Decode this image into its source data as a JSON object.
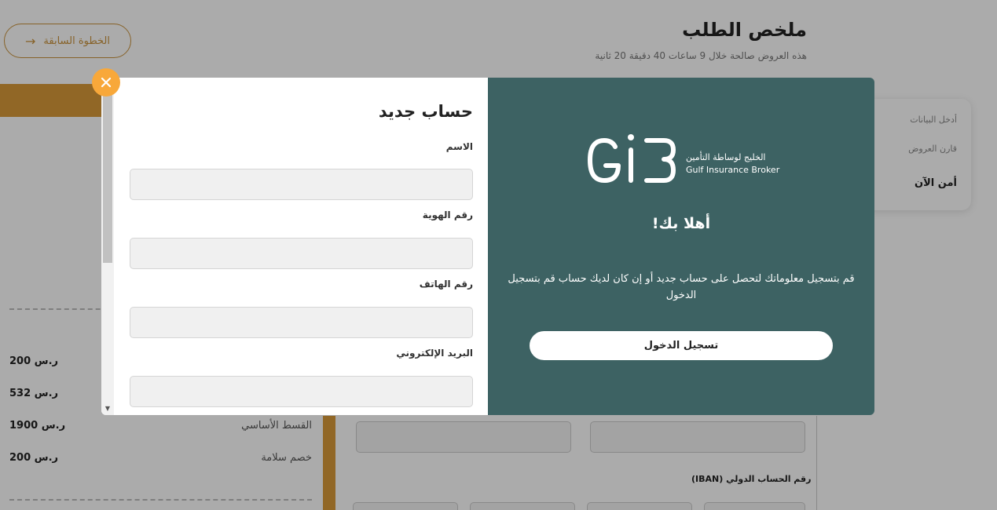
{
  "page": {
    "prev_button": "الخطوة السابقة",
    "title": "ملخص الطلب",
    "subtitle": "هذه العروض صالحة خلال 9 ساعات 40 دقيقة 20 ثانية",
    "steps": [
      "أدخل البيانات",
      "قارن العروض",
      "أمن الآن"
    ],
    "prices": [
      {
        "label": "",
        "value": "200 ر.س"
      },
      {
        "label": "",
        "value": "532 ر.س"
      },
      {
        "label": "القسط الأساسي",
        "value": "1900 ر.س"
      },
      {
        "label": "خصم سلامة",
        "value": "200 ر.س"
      }
    ],
    "iban_label": "رقم الحساب الدولي (IBAN)"
  },
  "modal": {
    "form": {
      "title": "حساب جديد",
      "fields": [
        {
          "label": "الاسم",
          "value": ""
        },
        {
          "label": "رقم الهوية",
          "value": ""
        },
        {
          "label": "رقم الهاتف",
          "value": ""
        },
        {
          "label": "البريد الإلكتروني",
          "value": ""
        }
      ]
    },
    "panel": {
      "logo_ar": "الخليج لوساطة التأمين",
      "logo_en": "Gulf Insurance Broker",
      "welcome": "أهلا بك!",
      "description": "قم بتسجيل معلوماتك لتحصل على حساب جديد أو إن كان لديك حساب قم بتسجيل الدخول",
      "login_button": "تسجيل الدخول"
    },
    "close_icon": "close-icon"
  },
  "colors": {
    "accent": "#d99a3a",
    "panel": "#3d6263",
    "close": "#f8a83a"
  }
}
